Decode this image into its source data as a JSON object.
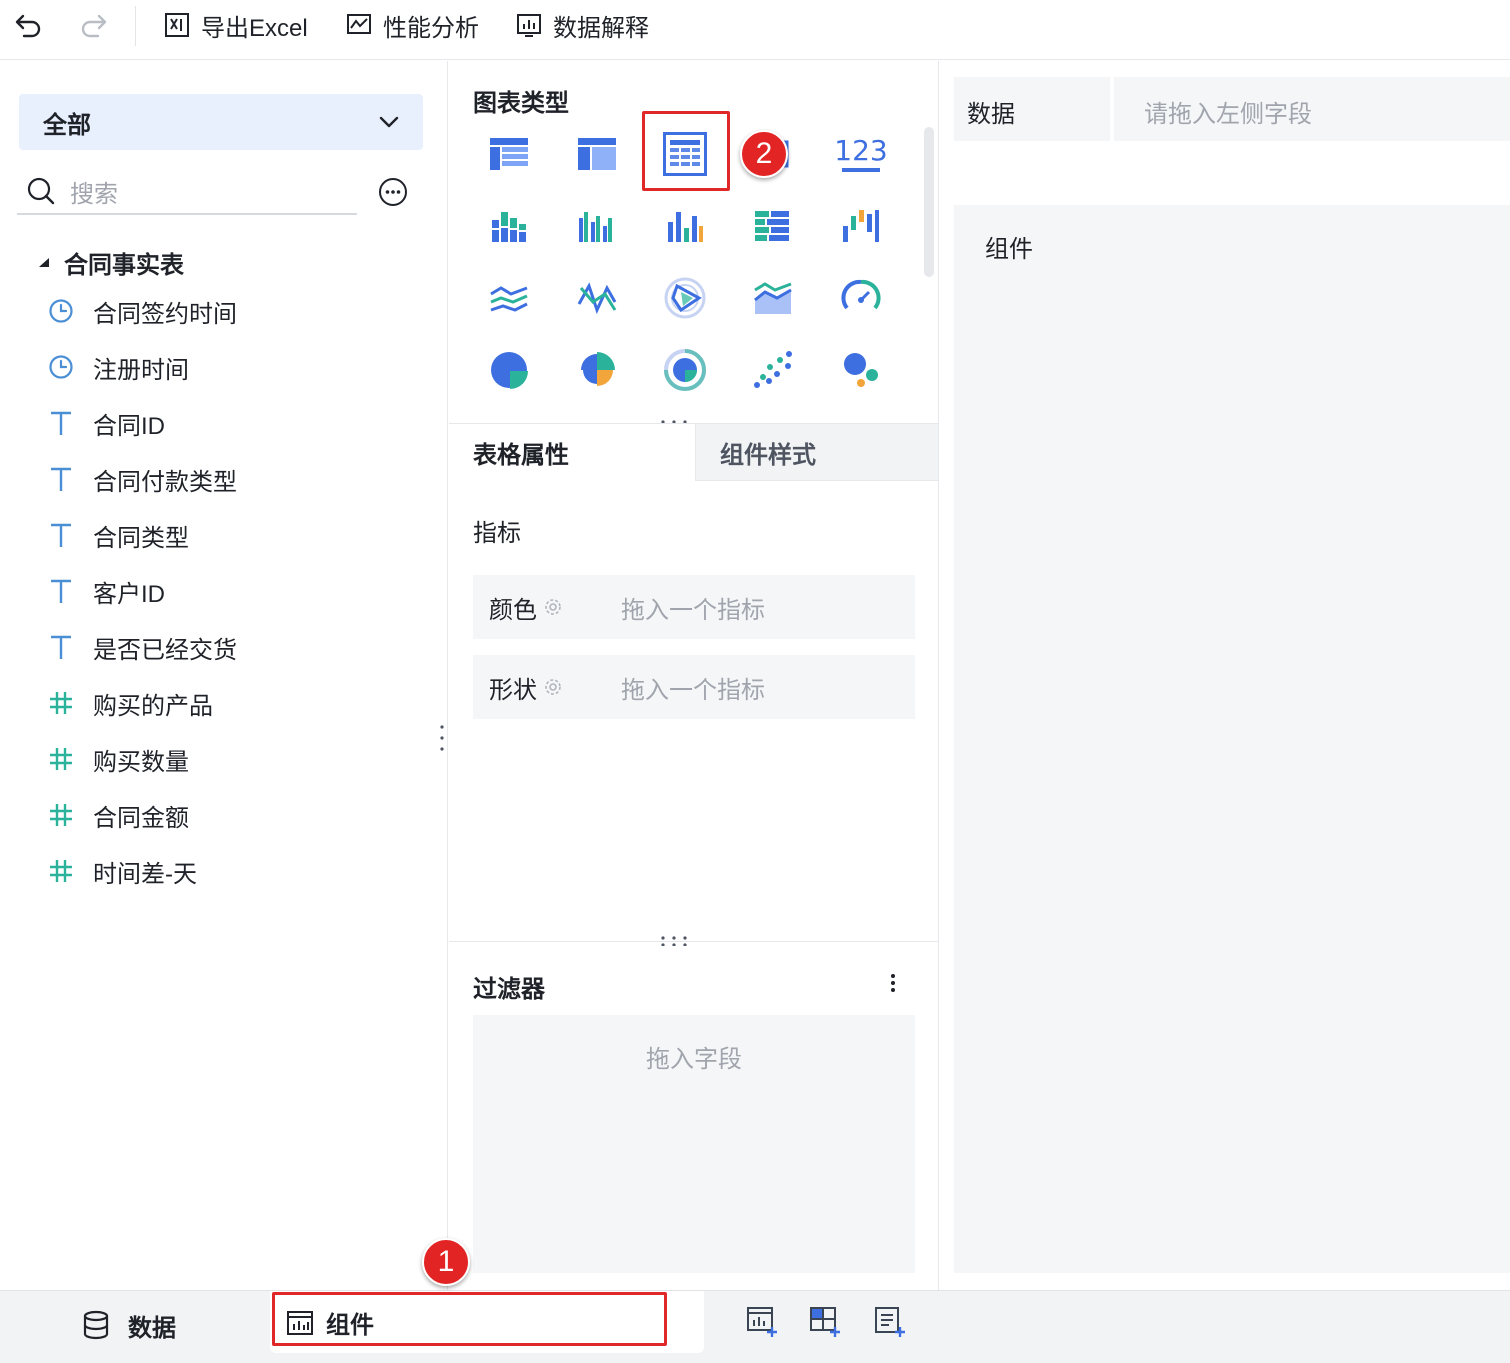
{
  "toolbar": {
    "export_excel": "导出Excel",
    "perf_analysis": "性能分析",
    "data_explain": "数据解释"
  },
  "left": {
    "scope": "全部",
    "search_placeholder": "搜索",
    "table_name": "合同事实表",
    "fields": [
      {
        "type": "time",
        "label": "合同签约时间"
      },
      {
        "type": "time",
        "label": "注册时间"
      },
      {
        "type": "text",
        "label": "合同ID"
      },
      {
        "type": "text",
        "label": "合同付款类型"
      },
      {
        "type": "text",
        "label": "合同类型"
      },
      {
        "type": "text",
        "label": "客户ID"
      },
      {
        "type": "text",
        "label": "是否已经交货"
      },
      {
        "type": "number",
        "label": "购买的产品"
      },
      {
        "type": "number",
        "label": "购买数量"
      },
      {
        "type": "number",
        "label": "合同金额"
      },
      {
        "type": "number",
        "label": "时间差-天"
      }
    ]
  },
  "middle": {
    "chart_types_title": "图表类型",
    "kpi_label": "123",
    "tab_active": "表格属性",
    "tab_inactive": "组件样式",
    "metric_label": "指标",
    "color_label": "颜色",
    "shape_label": "形状",
    "drop_metric_placeholder": "拖入一个指标",
    "filter_title": "过滤器",
    "filter_placeholder": "拖入字段"
  },
  "right": {
    "data_label": "数据",
    "data_placeholder": "请拖入左侧字段",
    "component_label": "组件"
  },
  "bottom": {
    "data_tab": "数据",
    "component_tab": "组件"
  },
  "annotations": {
    "badge1": "1",
    "badge2": "2"
  },
  "colors": {
    "accent_blue": "#3d6fe0",
    "highlight_red": "#e02828",
    "text_field_icon": "#4a8fd6",
    "number_field_icon": "#2ab39a"
  }
}
